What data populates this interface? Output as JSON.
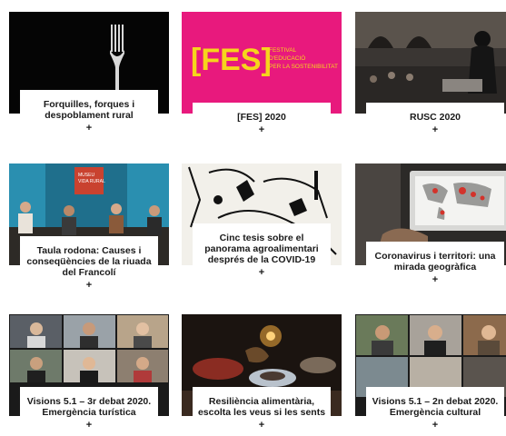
{
  "cards": [
    {
      "title": "Forquilles, forques i despoblament rural",
      "plus": "+"
    },
    {
      "title": "[FES] 2020",
      "plus": "+"
    },
    {
      "title": "RUSC 2020",
      "plus": "+"
    },
    {
      "title": "Taula rodona: Causes i conseqüències de la riuada del Francolí",
      "plus": "+"
    },
    {
      "title": "Cinc tesis sobre el panorama agroalimentari després de la COVID-19",
      "plus": "+"
    },
    {
      "title": "Coronavirus i territori: una mirada geogràfica",
      "plus": "+"
    },
    {
      "title": "Visions 5.1 – 3r debat 2020. Emergència turística",
      "plus": "+"
    },
    {
      "title": "Resiliència alimentària, escolta les veus si les sents",
      "plus": "+"
    },
    {
      "title": "Visions 5.1 – 2n debat 2020. Emergència cultural",
      "plus": "+"
    }
  ],
  "fes_logo": {
    "word": "[FES]",
    "line1": "FESTIVAL",
    "line2": "D'EDUCACIÓ",
    "line3": "PER LA SOSTENIBILITAT"
  },
  "museum_sign": {
    "line1": "MUSEU",
    "line2": "VIDA RURAL"
  },
  "colors": {
    "fes_pink": "#e8197d",
    "fes_yellow": "#f6d51c",
    "museum_red": "#c9422f",
    "text": "#1a1a1a"
  }
}
